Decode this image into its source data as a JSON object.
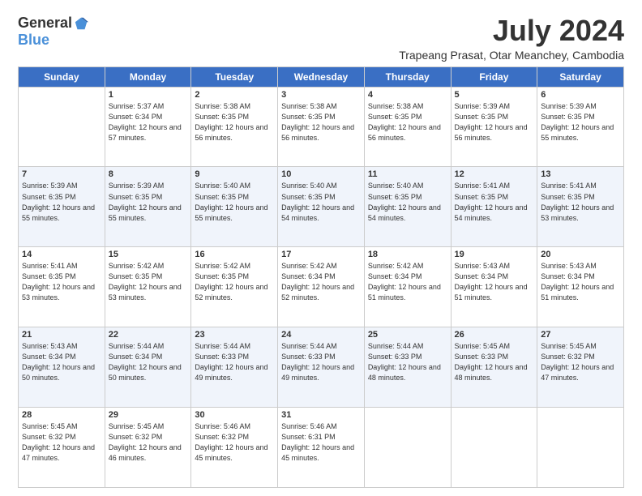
{
  "header": {
    "logo_general": "General",
    "logo_blue": "Blue",
    "month_year": "July 2024",
    "location": "Trapeang Prasat, Otar Meanchey, Cambodia"
  },
  "days_of_week": [
    "Sunday",
    "Monday",
    "Tuesday",
    "Wednesday",
    "Thursday",
    "Friday",
    "Saturday"
  ],
  "weeks": [
    [
      {
        "day": "",
        "sunrise": "",
        "sunset": "",
        "daylight": ""
      },
      {
        "day": "1",
        "sunrise": "Sunrise: 5:37 AM",
        "sunset": "Sunset: 6:34 PM",
        "daylight": "Daylight: 12 hours and 57 minutes."
      },
      {
        "day": "2",
        "sunrise": "Sunrise: 5:38 AM",
        "sunset": "Sunset: 6:35 PM",
        "daylight": "Daylight: 12 hours and 56 minutes."
      },
      {
        "day": "3",
        "sunrise": "Sunrise: 5:38 AM",
        "sunset": "Sunset: 6:35 PM",
        "daylight": "Daylight: 12 hours and 56 minutes."
      },
      {
        "day": "4",
        "sunrise": "Sunrise: 5:38 AM",
        "sunset": "Sunset: 6:35 PM",
        "daylight": "Daylight: 12 hours and 56 minutes."
      },
      {
        "day": "5",
        "sunrise": "Sunrise: 5:39 AM",
        "sunset": "Sunset: 6:35 PM",
        "daylight": "Daylight: 12 hours and 56 minutes."
      },
      {
        "day": "6",
        "sunrise": "Sunrise: 5:39 AM",
        "sunset": "Sunset: 6:35 PM",
        "daylight": "Daylight: 12 hours and 55 minutes."
      }
    ],
    [
      {
        "day": "7",
        "sunrise": "Sunrise: 5:39 AM",
        "sunset": "Sunset: 6:35 PM",
        "daylight": "Daylight: 12 hours and 55 minutes."
      },
      {
        "day": "8",
        "sunrise": "Sunrise: 5:39 AM",
        "sunset": "Sunset: 6:35 PM",
        "daylight": "Daylight: 12 hours and 55 minutes."
      },
      {
        "day": "9",
        "sunrise": "Sunrise: 5:40 AM",
        "sunset": "Sunset: 6:35 PM",
        "daylight": "Daylight: 12 hours and 55 minutes."
      },
      {
        "day": "10",
        "sunrise": "Sunrise: 5:40 AM",
        "sunset": "Sunset: 6:35 PM",
        "daylight": "Daylight: 12 hours and 54 minutes."
      },
      {
        "day": "11",
        "sunrise": "Sunrise: 5:40 AM",
        "sunset": "Sunset: 6:35 PM",
        "daylight": "Daylight: 12 hours and 54 minutes."
      },
      {
        "day": "12",
        "sunrise": "Sunrise: 5:41 AM",
        "sunset": "Sunset: 6:35 PM",
        "daylight": "Daylight: 12 hours and 54 minutes."
      },
      {
        "day": "13",
        "sunrise": "Sunrise: 5:41 AM",
        "sunset": "Sunset: 6:35 PM",
        "daylight": "Daylight: 12 hours and 53 minutes."
      }
    ],
    [
      {
        "day": "14",
        "sunrise": "Sunrise: 5:41 AM",
        "sunset": "Sunset: 6:35 PM",
        "daylight": "Daylight: 12 hours and 53 minutes."
      },
      {
        "day": "15",
        "sunrise": "Sunrise: 5:42 AM",
        "sunset": "Sunset: 6:35 PM",
        "daylight": "Daylight: 12 hours and 53 minutes."
      },
      {
        "day": "16",
        "sunrise": "Sunrise: 5:42 AM",
        "sunset": "Sunset: 6:35 PM",
        "daylight": "Daylight: 12 hours and 52 minutes."
      },
      {
        "day": "17",
        "sunrise": "Sunrise: 5:42 AM",
        "sunset": "Sunset: 6:34 PM",
        "daylight": "Daylight: 12 hours and 52 minutes."
      },
      {
        "day": "18",
        "sunrise": "Sunrise: 5:42 AM",
        "sunset": "Sunset: 6:34 PM",
        "daylight": "Daylight: 12 hours and 51 minutes."
      },
      {
        "day": "19",
        "sunrise": "Sunrise: 5:43 AM",
        "sunset": "Sunset: 6:34 PM",
        "daylight": "Daylight: 12 hours and 51 minutes."
      },
      {
        "day": "20",
        "sunrise": "Sunrise: 5:43 AM",
        "sunset": "Sunset: 6:34 PM",
        "daylight": "Daylight: 12 hours and 51 minutes."
      }
    ],
    [
      {
        "day": "21",
        "sunrise": "Sunrise: 5:43 AM",
        "sunset": "Sunset: 6:34 PM",
        "daylight": "Daylight: 12 hours and 50 minutes."
      },
      {
        "day": "22",
        "sunrise": "Sunrise: 5:44 AM",
        "sunset": "Sunset: 6:34 PM",
        "daylight": "Daylight: 12 hours and 50 minutes."
      },
      {
        "day": "23",
        "sunrise": "Sunrise: 5:44 AM",
        "sunset": "Sunset: 6:33 PM",
        "daylight": "Daylight: 12 hours and 49 minutes."
      },
      {
        "day": "24",
        "sunrise": "Sunrise: 5:44 AM",
        "sunset": "Sunset: 6:33 PM",
        "daylight": "Daylight: 12 hours and 49 minutes."
      },
      {
        "day": "25",
        "sunrise": "Sunrise: 5:44 AM",
        "sunset": "Sunset: 6:33 PM",
        "daylight": "Daylight: 12 hours and 48 minutes."
      },
      {
        "day": "26",
        "sunrise": "Sunrise: 5:45 AM",
        "sunset": "Sunset: 6:33 PM",
        "daylight": "Daylight: 12 hours and 48 minutes."
      },
      {
        "day": "27",
        "sunrise": "Sunrise: 5:45 AM",
        "sunset": "Sunset: 6:32 PM",
        "daylight": "Daylight: 12 hours and 47 minutes."
      }
    ],
    [
      {
        "day": "28",
        "sunrise": "Sunrise: 5:45 AM",
        "sunset": "Sunset: 6:32 PM",
        "daylight": "Daylight: 12 hours and 47 minutes."
      },
      {
        "day": "29",
        "sunrise": "Sunrise: 5:45 AM",
        "sunset": "Sunset: 6:32 PM",
        "daylight": "Daylight: 12 hours and 46 minutes."
      },
      {
        "day": "30",
        "sunrise": "Sunrise: 5:46 AM",
        "sunset": "Sunset: 6:32 PM",
        "daylight": "Daylight: 12 hours and 45 minutes."
      },
      {
        "day": "31",
        "sunrise": "Sunrise: 5:46 AM",
        "sunset": "Sunset: 6:31 PM",
        "daylight": "Daylight: 12 hours and 45 minutes."
      },
      {
        "day": "",
        "sunrise": "",
        "sunset": "",
        "daylight": ""
      },
      {
        "day": "",
        "sunrise": "",
        "sunset": "",
        "daylight": ""
      },
      {
        "day": "",
        "sunrise": "",
        "sunset": "",
        "daylight": ""
      }
    ]
  ]
}
